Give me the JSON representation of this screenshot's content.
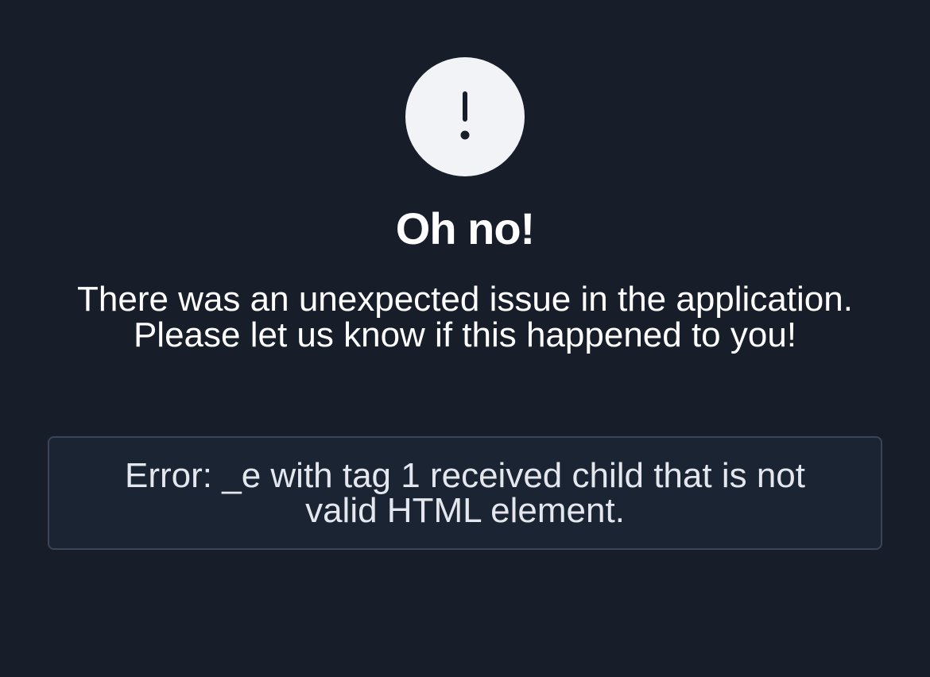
{
  "icon": {
    "name": "exclamation-icon",
    "circle_color": "#f1f3f7",
    "glyph_color": "#171d29"
  },
  "title": "Oh no!",
  "message": "There was an unexpected issue in the application. Please let us know if this happened to you!",
  "error": {
    "text": "Error: _e with tag 1 received child that is not valid HTML element."
  },
  "colors": {
    "background": "#171d29",
    "error_box_background": "#1b2432",
    "error_box_border": "#3a4558"
  }
}
